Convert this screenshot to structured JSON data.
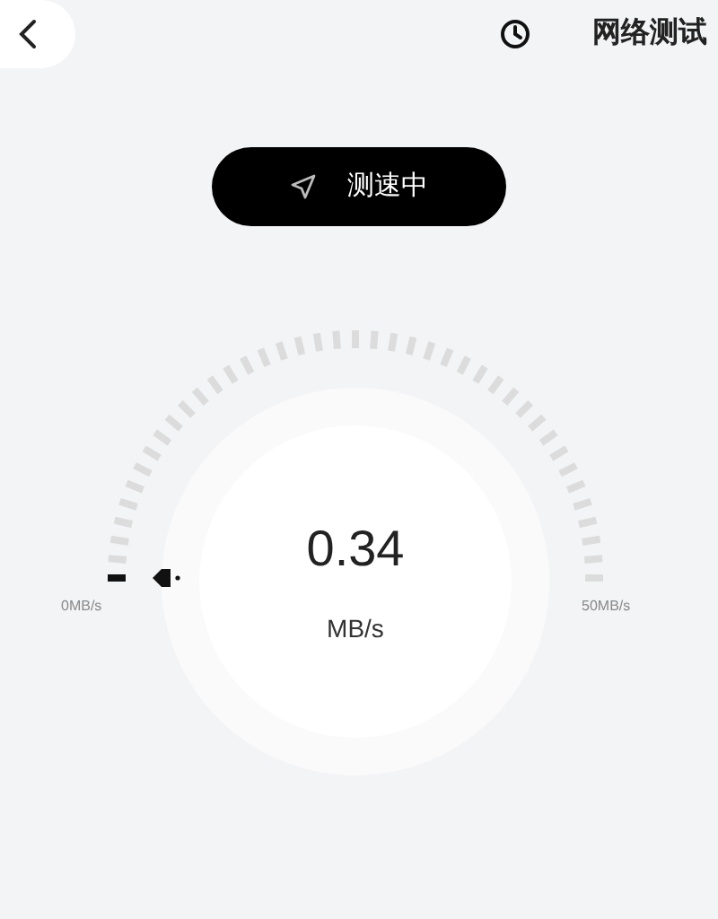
{
  "header": {
    "title": "网络测试"
  },
  "status_button": {
    "label": "测速中"
  },
  "gauge": {
    "value": "0.34",
    "unit": "MB/s",
    "min_label": "0MB/s",
    "max_label": "50MB/s"
  }
}
